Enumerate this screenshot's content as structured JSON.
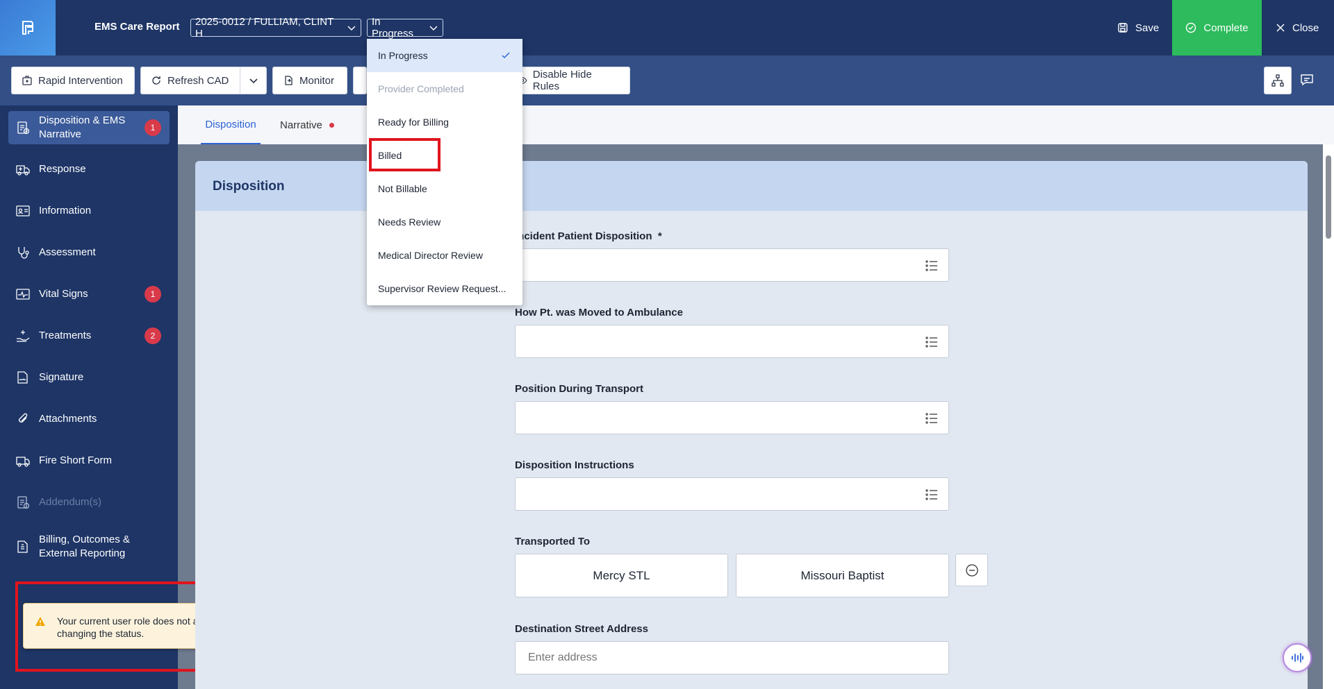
{
  "header": {
    "app_title": "EMS Care Report",
    "patient_select": "2025-0012 / FULLIAM, CLINT H",
    "status_select": "In Progress",
    "save_label": "Save",
    "complete_label": "Complete",
    "close_label": "Close"
  },
  "toolbar": {
    "rapid_intervention": "Rapid Intervention",
    "refresh_cad": "Refresh CAD",
    "monitor": "Monitor",
    "disable_hide_rules": "Disable Hide Rules"
  },
  "status_dropdown": {
    "options": [
      {
        "label": "In Progress",
        "state": "selected"
      },
      {
        "label": "Provider Completed",
        "state": "disabled"
      },
      {
        "label": "Ready for Billing",
        "state": "normal"
      },
      {
        "label": "Billed",
        "state": "normal"
      },
      {
        "label": "Not Billable",
        "state": "normal"
      },
      {
        "label": "Needs Review",
        "state": "normal"
      },
      {
        "label": "Medical Director Review",
        "state": "normal"
      },
      {
        "label": "Supervisor Review Request...",
        "state": "normal"
      }
    ]
  },
  "sidebar": {
    "items": [
      {
        "label": "Disposition & EMS Narrative",
        "badge": "1",
        "icon": "clipboard-check-icon"
      },
      {
        "label": "Response",
        "icon": "ambulance-icon"
      },
      {
        "label": "Information",
        "icon": "id-card-icon"
      },
      {
        "label": "Assessment",
        "icon": "stethoscope-icon"
      },
      {
        "label": "Vital Signs",
        "badge": "1",
        "icon": "pulse-icon"
      },
      {
        "label": "Treatments",
        "badge": "2",
        "icon": "hand-medical-icon"
      },
      {
        "label": "Signature",
        "icon": "signature-icon"
      },
      {
        "label": "Attachments",
        "icon": "paperclip-icon"
      },
      {
        "label": "Fire Short Form",
        "icon": "truck-icon"
      },
      {
        "label": "Addendum(s)",
        "icon": "document-icon"
      },
      {
        "label": "Billing, Outcomes & External Reporting",
        "icon": "billing-icon"
      }
    ]
  },
  "toast": {
    "message": "Your current user role does not allow changing the status."
  },
  "tabs": [
    {
      "label": "Disposition"
    },
    {
      "label": "Narrative"
    }
  ],
  "panel": {
    "title": "Disposition",
    "fields": {
      "incident_disposition": "Incident Patient Disposition",
      "required_mark": "*",
      "moved_to_ambulance": "How Pt. was Moved to Ambulance",
      "position_transport": "Position During Transport",
      "disposition_instructions": "Disposition Instructions",
      "transported_to": "Transported To",
      "destination_address": "Destination Street Address"
    },
    "destinations": [
      "Mercy STL",
      "Missouri Baptist"
    ],
    "address_placeholder": "Enter address"
  },
  "colors": {
    "header_bg": "#1e3566",
    "toolbar_bg": "#334f86",
    "complete_green": "#2dbb5d",
    "accent_blue": "#2e63d5",
    "badge_red": "#d93a4a",
    "highlight_red": "#e0141e"
  }
}
